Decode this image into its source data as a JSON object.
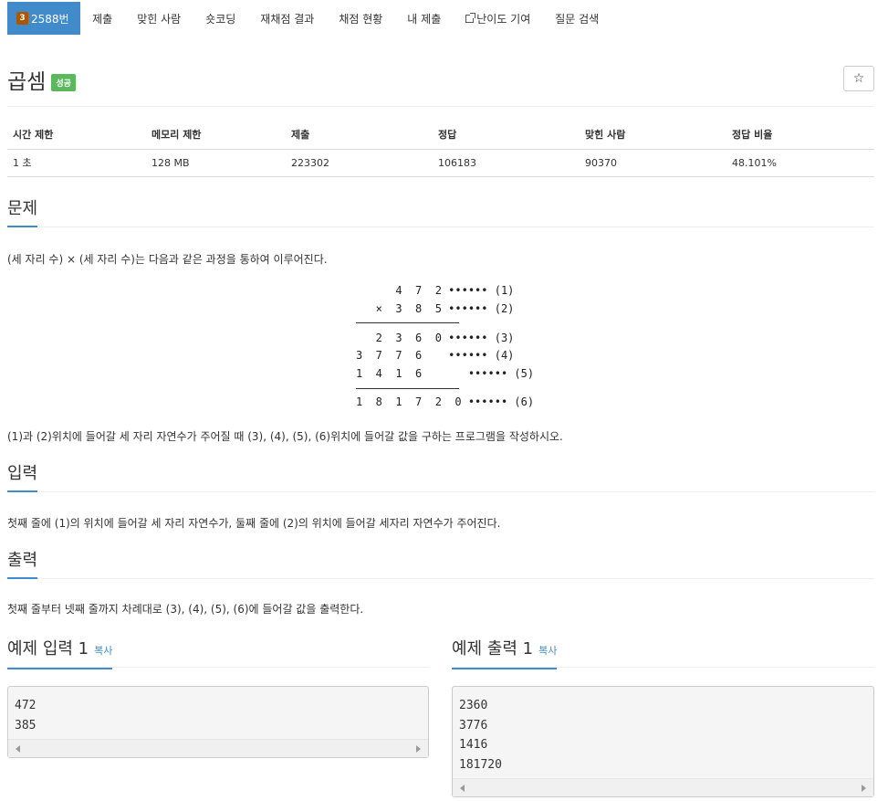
{
  "nav": {
    "active": {
      "tier": "3",
      "label": "2588번"
    },
    "items": [
      "제출",
      "맞힌 사람",
      "숏코딩",
      "재채점 결과",
      "채점 현황",
      "내 제출",
      "난이도 기여",
      "질문 검색"
    ]
  },
  "problem": {
    "title": "곱셈",
    "status_badge": "성공"
  },
  "info": {
    "headers": [
      "시간 제한",
      "메모리 제한",
      "제출",
      "정답",
      "맞힌 사람",
      "정답 비율"
    ],
    "values": [
      "1 초",
      "128 MB",
      "223302",
      "106183",
      "90370",
      "48.101%"
    ]
  },
  "sections": {
    "problem_title": "문제",
    "problem_text": "(세 자리 수) × (세 자리 수)는 다음과 같은 과정을 통하여 이루어진다.",
    "problem_text2": "(1)과 (2)위치에 들어갈 세 자리 자연수가 주어질 때 (3), (4), (5), (6)위치에 들어갈 값을 구하는 프로그램을 작성하시오.",
    "input_title": "입력",
    "input_text": "첫째 줄에 (1)의 위치에 들어갈 세 자리 자연수가, 둘째 줄에 (2)의 위치에 들어갈 세자리 자연수가 주어진다.",
    "output_title": "출력",
    "output_text": "첫째 줄부터 넷째 줄까지 차례대로 (3), (4), (5), (6)에 들어갈 값을 출력한다."
  },
  "figure": {
    "rows": [
      "      4  7  2 •••••• (1)",
      "   ×  3  8  5 •••••• (2)",
      "   2  3  6  0 •••••• (3)",
      "3  7  7  6    •••••• (4)",
      "1  4  1  6       •••••• (5)",
      "1  8  1  7  2  0 •••••• (6)"
    ]
  },
  "samples": {
    "input_title": "예제 입력 1",
    "output_title": "예제 출력 1",
    "copy_label": "복사",
    "input_lines": [
      "472",
      "385"
    ],
    "output_lines": [
      "2360",
      "3776",
      "1416",
      "181720"
    ]
  }
}
